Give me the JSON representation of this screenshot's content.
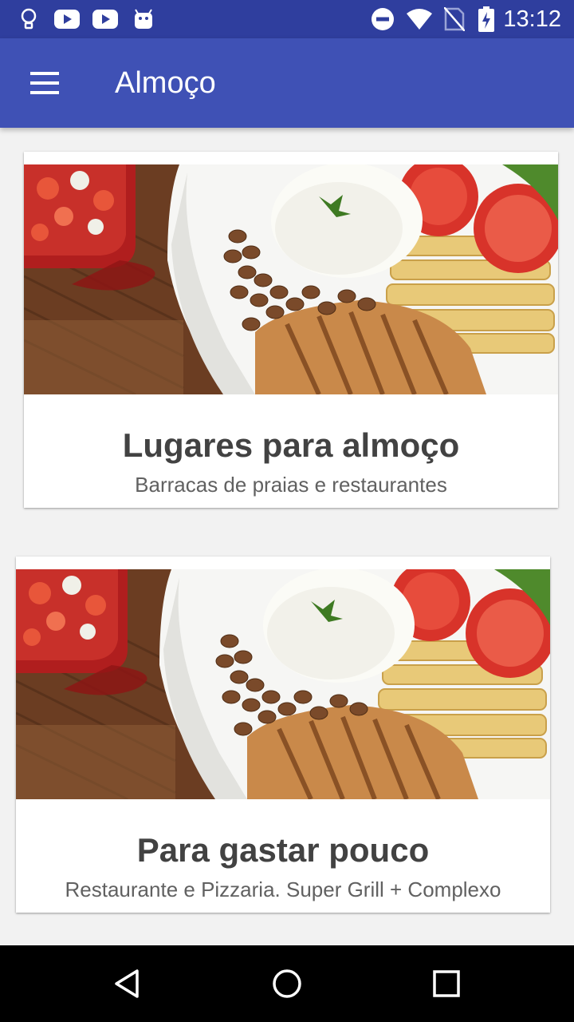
{
  "status_bar": {
    "time": "13:12",
    "icons": [
      "lightbulb-icon",
      "youtube-icon",
      "youtube-icon",
      "android-icon",
      "do-not-disturb-icon",
      "wifi-icon",
      "no-sim-icon",
      "battery-charging-icon"
    ]
  },
  "app_bar": {
    "title": "Almoço",
    "menu_icon": "hamburger-menu-icon"
  },
  "cards": [
    {
      "title": "Lugares para almoço",
      "subtitle": "Barracas de praias e restaurantes",
      "image": "lunch-plate-photo"
    },
    {
      "title": "Para gastar pouco",
      "subtitle": "Restaurante e Pizzaria. Super Grill + Complexo",
      "image": "lunch-plate-photo"
    }
  ],
  "nav_bar": {
    "buttons": [
      "back-icon",
      "home-icon",
      "recents-icon"
    ]
  },
  "colors": {
    "status_bar": "#2f3e9e",
    "app_bar": "#3f51b5",
    "background": "#f2f2f2",
    "card_title": "#424242",
    "card_subtitle": "#616161"
  }
}
